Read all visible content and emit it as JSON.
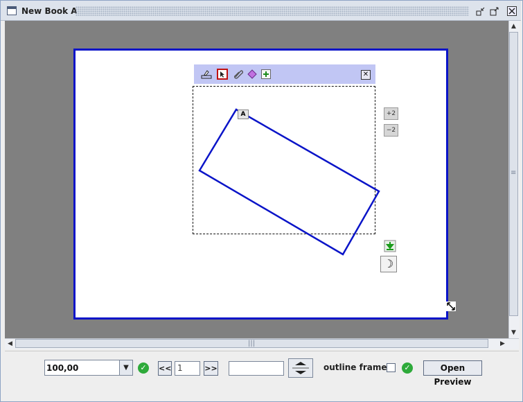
{
  "window": {
    "title": "New Book A",
    "controls": {
      "minimize": "▫↙",
      "restore": "▫↗",
      "close": "✕"
    }
  },
  "canvas": {
    "frame_toolbar_icons": [
      "paint-icon",
      "select-cursor-icon",
      "paperclip-icon",
      "diamond-icon",
      "plus-icon"
    ],
    "frame_close": "✕",
    "shape_tag": "A",
    "side_buttons": {
      "layer_up": "+2",
      "layer_down": "−2"
    },
    "rotate_glyph": "☽"
  },
  "bottom": {
    "zoom_value": "100,00",
    "prev_label": "<<",
    "page_number": "1",
    "next_label": ">>",
    "search_value": "",
    "outline_label": "outline frames",
    "preview_label": "Open Preview"
  },
  "colors": {
    "page_border": "#0a14c8",
    "shape_stroke": "#0a14c8",
    "toolbar": "#c1c6f4",
    "ok_green": "#2eaa3a"
  }
}
